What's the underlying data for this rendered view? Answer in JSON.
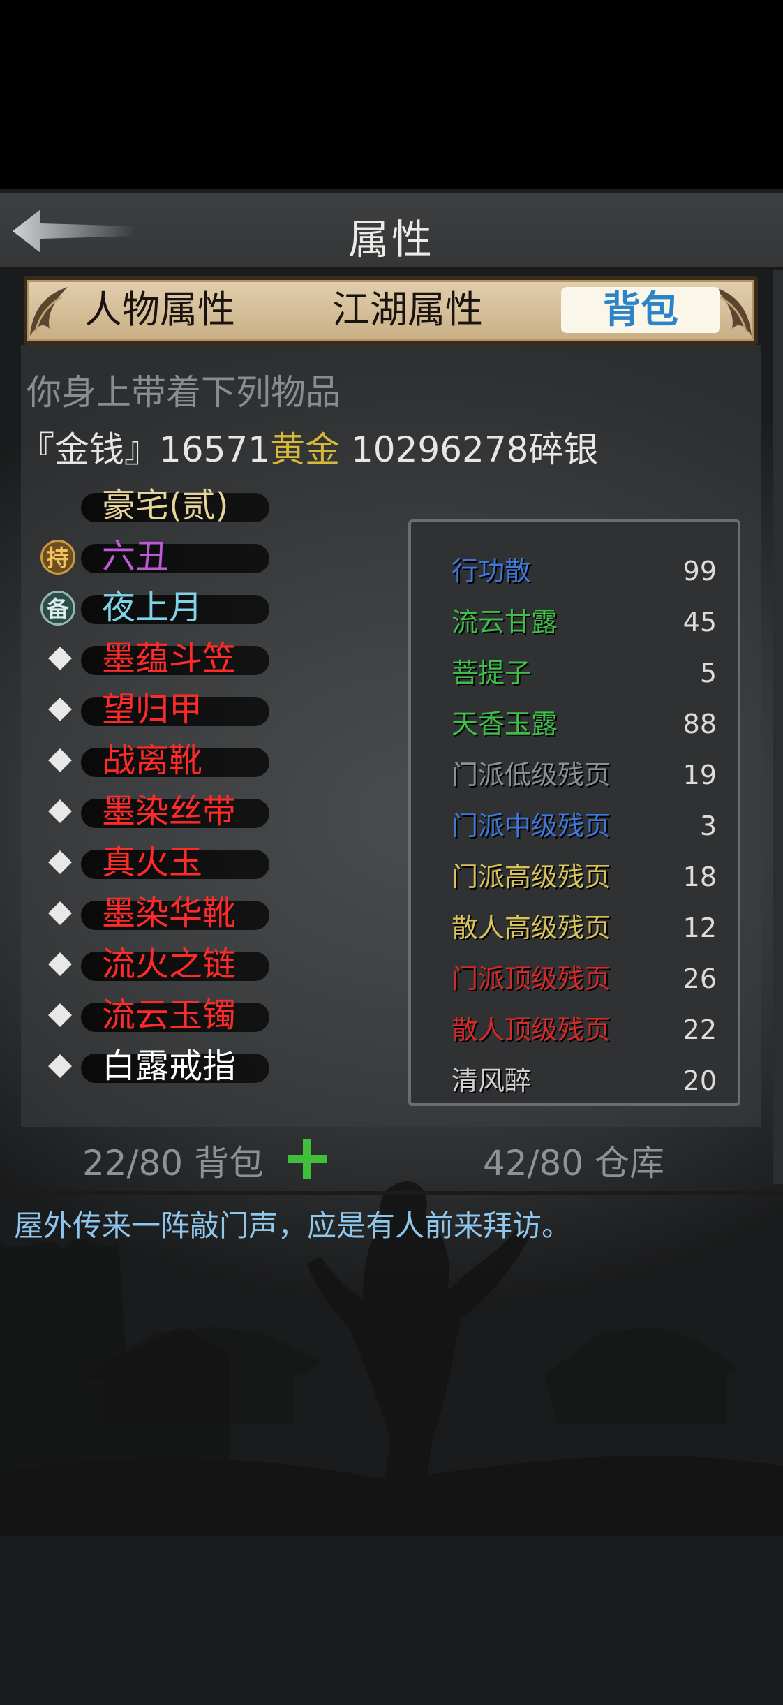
{
  "header": {
    "title": "属性",
    "back_label": "返回"
  },
  "tabs": [
    {
      "label": "人物属性",
      "active": false
    },
    {
      "label": "江湖属性",
      "active": false
    },
    {
      "label": "背包",
      "active": true
    }
  ],
  "inventory": {
    "heading": "你身上带着下列物品",
    "money": {
      "prefix": "『金钱』",
      "gold": "16571",
      "gold_unit": "黄金",
      "silver": "10296278",
      "silver_unit": "碎银"
    },
    "equipment": [
      {
        "name": "豪宅(贰)",
        "color": "#e6d49a",
        "marker": "none"
      },
      {
        "name": "六丑",
        "color": "#c05bd8",
        "marker": "hold",
        "marker_label": "持"
      },
      {
        "name": "夜上月",
        "color": "#7fd3e8",
        "marker": "spare",
        "marker_label": "备"
      },
      {
        "name": "墨蕴斗笠",
        "color": "#ff2a2a",
        "marker": "diamond"
      },
      {
        "name": "望归甲",
        "color": "#ff2a2a",
        "marker": "diamond"
      },
      {
        "name": "战离靴",
        "color": "#ff2a2a",
        "marker": "diamond"
      },
      {
        "name": "墨染丝带",
        "color": "#ff2a2a",
        "marker": "diamond"
      },
      {
        "name": "真火玉",
        "color": "#ff2a2a",
        "marker": "diamond"
      },
      {
        "name": "墨染华靴",
        "color": "#ff2a2a",
        "marker": "diamond"
      },
      {
        "name": "流火之链",
        "color": "#ff2a2a",
        "marker": "diamond"
      },
      {
        "name": "流云玉镯",
        "color": "#ff2a2a",
        "marker": "diamond"
      },
      {
        "name": "白露戒指",
        "color": "#ffffff",
        "marker": "diamond"
      }
    ],
    "consumables": [
      {
        "name": "行功散",
        "count": "99",
        "color": "#3f78d8"
      },
      {
        "name": "流云甘露",
        "count": "45",
        "color": "#3fbf4a"
      },
      {
        "name": "菩提子",
        "count": "5",
        "color": "#3fbf4a"
      },
      {
        "name": "天香玉露",
        "count": "88",
        "color": "#3fbf4a"
      },
      {
        "name": "门派低级残页",
        "count": "19",
        "color": "#8a9097"
      },
      {
        "name": "门派中级残页",
        "count": "3",
        "color": "#3f78d8"
      },
      {
        "name": "门派高级残页",
        "count": "18",
        "color": "#d8c25a"
      },
      {
        "name": "散人高级残页",
        "count": "12",
        "color": "#d8c25a"
      },
      {
        "name": "门派顶级残页",
        "count": "26",
        "color": "#d42a2a"
      },
      {
        "name": "散人顶级残页",
        "count": "22",
        "color": "#d42a2a"
      },
      {
        "name": "清风醉",
        "count": "20",
        "color": "#d0d0d0"
      }
    ],
    "bag_counter": "22/80 背包",
    "storage_counter": "42/80 仓库"
  },
  "message": "屋外传来一阵敲门声，应是有人前来拜访。",
  "colors": {
    "accent_tab": "#2b84c8",
    "gold": "#d7b838",
    "message": "#8ec6ec",
    "add_button": "#3fbf3a"
  }
}
